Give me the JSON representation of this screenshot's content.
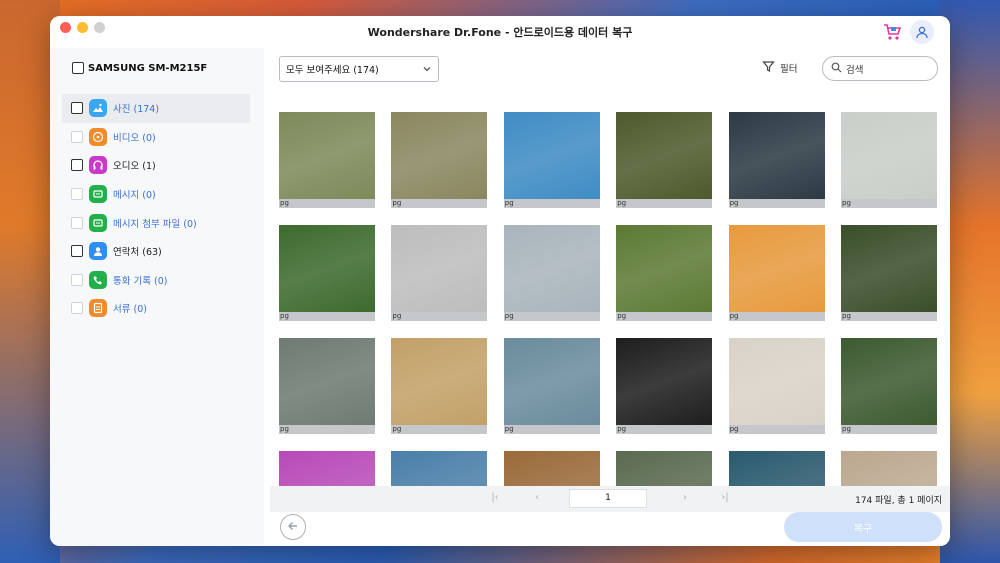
{
  "window": {
    "title": "Wondershare Dr.Fone - 안드로이드용 데이터 복구"
  },
  "sidebar": {
    "device": "SAMSUNG SM-M215F",
    "items": [
      {
        "label": "사진 (174)",
        "icon": "photo-icon",
        "color": "#3aa8f0",
        "selected": true,
        "enabled": true
      },
      {
        "label": "비디오 (0)",
        "icon": "video-icon",
        "color": "#f08a2a",
        "selected": false,
        "enabled": false
      },
      {
        "label": "오디오 (1)",
        "icon": "headphone-icon",
        "color": "#c93ac9",
        "selected": false,
        "enabled": true
      },
      {
        "label": "메시지 (0)",
        "icon": "message-icon",
        "color": "#22b04a",
        "selected": false,
        "enabled": false
      },
      {
        "label": "메시지 첨부 파일 (0)",
        "icon": "attachment-icon",
        "color": "#22b04a",
        "selected": false,
        "enabled": false
      },
      {
        "label": "연락처 (63)",
        "icon": "contact-icon",
        "color": "#2f8ef0",
        "selected": false,
        "enabled": true
      },
      {
        "label": "통화 기록  (0)",
        "icon": "phone-icon",
        "color": "#22b04a",
        "selected": false,
        "enabled": false
      },
      {
        "label": "서류 (0)",
        "icon": "document-icon",
        "color": "#f08a2a",
        "selected": false,
        "enabled": false
      }
    ]
  },
  "toolbar": {
    "select_value": "모두 보여주세요 (174)",
    "filter_label": "필터",
    "search_placeholder": "검색"
  },
  "thumbnails": [
    {
      "caption": "pg",
      "bg": "#7d8a5a"
    },
    {
      "caption": "pg",
      "bg": "#8a8760"
    },
    {
      "caption": "pg",
      "bg": "#3f8cc4"
    },
    {
      "caption": "pg",
      "bg": "#4d5a2c"
    },
    {
      "caption": "pg",
      "bg": "#2c3a44"
    },
    {
      "caption": "pg",
      "bg": "#c8cec8"
    },
    {
      "caption": "pg",
      "bg": "#3d6a2e"
    },
    {
      "caption": "pg",
      "bg": "#bdbdbd"
    },
    {
      "caption": "pg",
      "bg": "#a9b4bc"
    },
    {
      "caption": "pg",
      "bg": "#5c7a34"
    },
    {
      "caption": "pg",
      "bg": "#e79a3e"
    },
    {
      "caption": "pg",
      "bg": "#3a4e2a"
    },
    {
      "caption": "pg",
      "bg": "#6e7a72"
    },
    {
      "caption": "pg",
      "bg": "#c2a168"
    },
    {
      "caption": "pg",
      "bg": "#6a8c9c"
    },
    {
      "caption": "pg",
      "bg": "#1e1e1e"
    },
    {
      "caption": "pg",
      "bg": "#d9d2c8"
    },
    {
      "caption": "pg",
      "bg": "#3c5a30"
    },
    {
      "caption": "",
      "bg": "#b84ab8"
    },
    {
      "caption": "",
      "bg": "#4a7fa8"
    },
    {
      "caption": "",
      "bg": "#9a6a3a"
    },
    {
      "caption": "",
      "bg": "#5a6a50"
    },
    {
      "caption": "",
      "bg": "#2a5a6e"
    },
    {
      "caption": "",
      "bg": "#bca890"
    }
  ],
  "pager": {
    "current_page": "1",
    "summary": "174 파일, 총 1 페이지"
  },
  "actions": {
    "recover_label": "복구"
  },
  "colors": {
    "accent": "#3b6fd6",
    "recover_disabled": "#cfe0fb"
  }
}
